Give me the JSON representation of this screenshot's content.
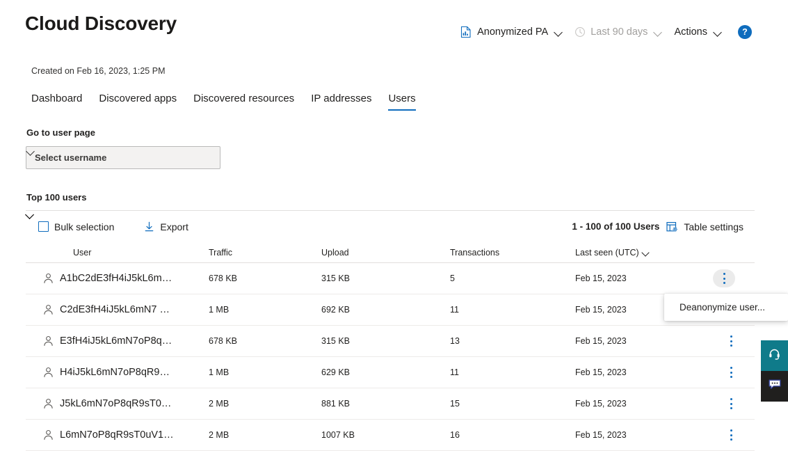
{
  "header": {
    "title": "Cloud Discovery",
    "actions": [
      {
        "label": "Anonymized PA",
        "icon": "report-icon",
        "disabled": false,
        "has_caret": true
      },
      {
        "label": "Last 90 days",
        "icon": "clock-icon",
        "disabled": true,
        "has_caret": true
      },
      {
        "label": "Actions",
        "icon": "",
        "disabled": false,
        "has_caret": true
      }
    ],
    "help_label": "?",
    "help_icon": "help-circle-icon"
  },
  "meta": {
    "created_on": "Created on Feb 16, 2023, 1:25 PM"
  },
  "tabs": [
    {
      "label": "Dashboard",
      "active": false
    },
    {
      "label": "Discovered apps",
      "active": false
    },
    {
      "label": "Discovered resources",
      "active": false
    },
    {
      "label": "IP addresses",
      "active": false
    },
    {
      "label": "Users",
      "active": true
    }
  ],
  "user_page": {
    "label": "Go to user page",
    "select_placeholder": "Select username",
    "caret_icon": "chevron-down-icon"
  },
  "table_section": {
    "title": "Top 100 users",
    "toolbar": {
      "bulk_selection_label": "Bulk selection",
      "export_label": "Export",
      "export_icon": "download-icon",
      "count_text": "1 - 100 of 100 Users",
      "table_settings_label": "Table settings",
      "table_settings_icon": "table-settings-icon"
    },
    "columns": [
      "User",
      "Traffic",
      "Upload",
      "Transactions",
      "Last seen (UTC)"
    ],
    "sort_column": "Last seen (UTC)",
    "sort_caret_icon": "chevron-down-icon",
    "row_icon": "user-icon",
    "row_menu_icon": "more-vertical-icon",
    "rows": [
      {
        "user": "A1bC2dE3fH4iJ5kL6m…",
        "traffic": "678 KB",
        "upload": "315 KB",
        "transactions": "5",
        "last_seen": "Feb 15, 2023",
        "menu_open": true
      },
      {
        "user": "C2dE3fH4iJ5kL6mN7 …",
        "traffic": "1 MB",
        "upload": "692 KB",
        "transactions": "11",
        "last_seen": "Feb 15, 2023",
        "menu_open": false
      },
      {
        "user": "E3fH4iJ5kL6mN7oP8q…",
        "traffic": "678 KB",
        "upload": "315 KB",
        "transactions": "13",
        "last_seen": "Feb 15, 2023",
        "menu_open": false
      },
      {
        "user": "H4iJ5kL6mN7oP8qR9…",
        "traffic": "1 MB",
        "upload": "629 KB",
        "transactions": "11",
        "last_seen": "Feb 15, 2023",
        "menu_open": false
      },
      {
        "user": "J5kL6mN7oP8qR9sT0…",
        "traffic": "2 MB",
        "upload": "881 KB",
        "transactions": "15",
        "last_seen": "Feb 15, 2023",
        "menu_open": false
      },
      {
        "user": "L6mN7oP8qR9sT0uV1…",
        "traffic": "2 MB",
        "upload": "1007 KB",
        "transactions": "16",
        "last_seen": "Feb 15, 2023",
        "menu_open": false
      }
    ]
  },
  "context_menu": {
    "items": [
      {
        "label": "Deanonymize user..."
      }
    ]
  },
  "side_buttons": [
    {
      "name": "support-button",
      "icon": "headset-icon",
      "color": "#0f7b8a"
    },
    {
      "name": "feedback-button",
      "icon": "feedback-chat-icon",
      "color": "#201f1e"
    }
  ]
}
